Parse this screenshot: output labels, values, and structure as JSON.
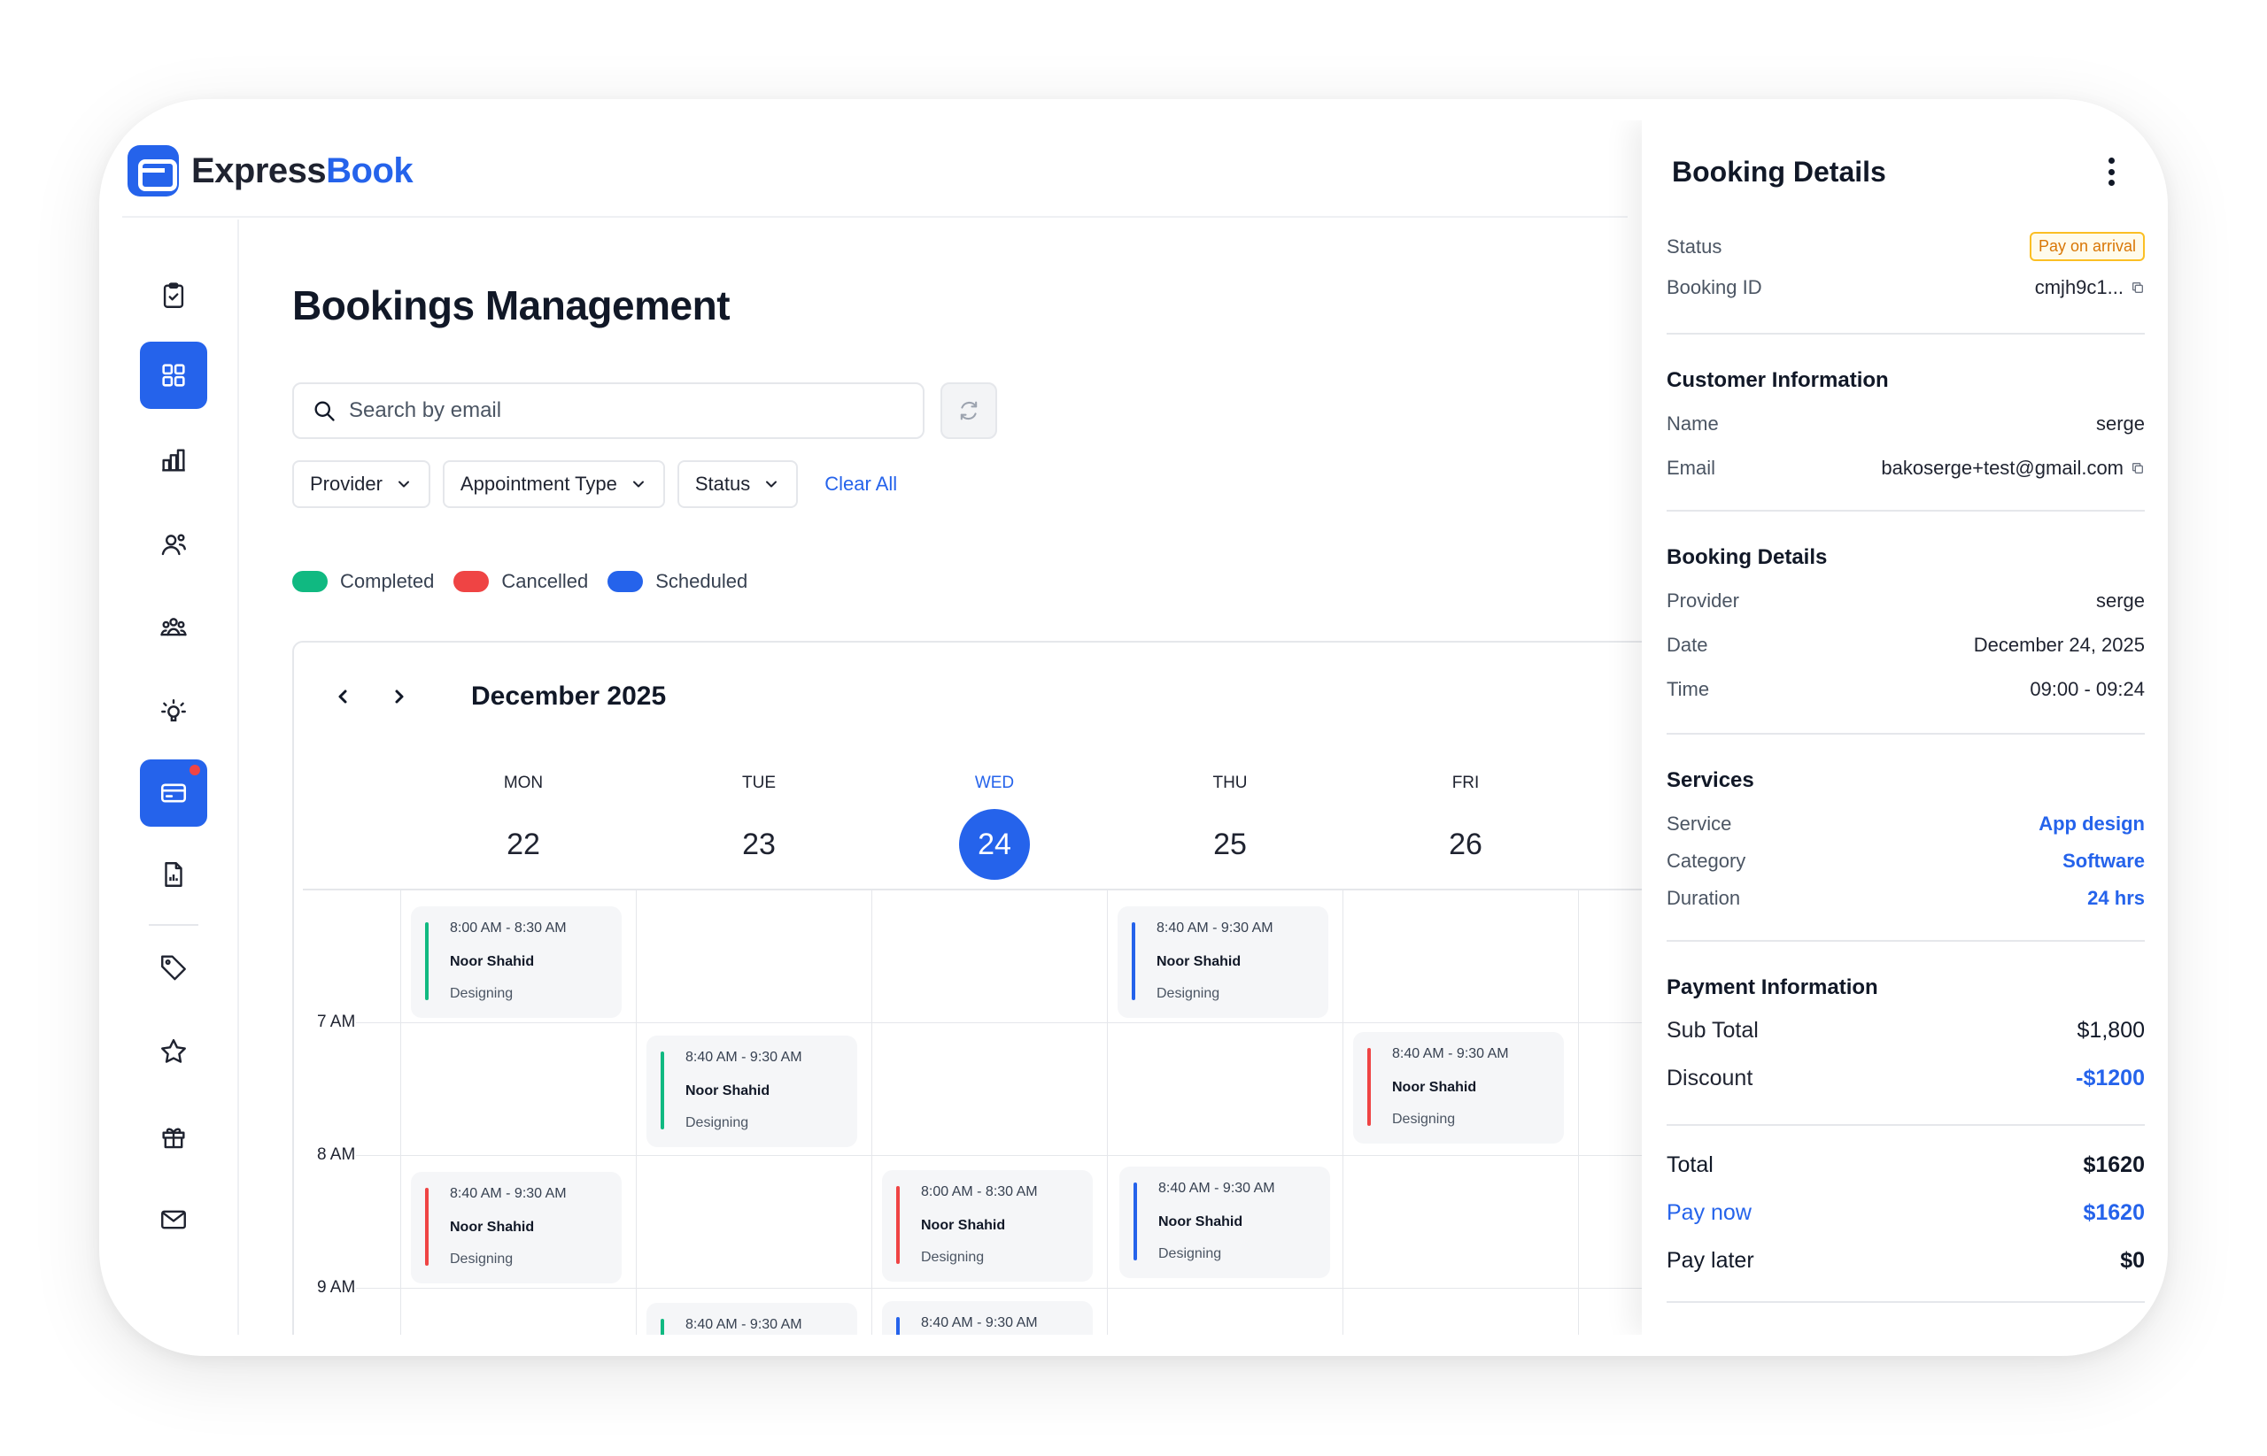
{
  "app": {
    "brand_part1": "Express",
    "brand_part2": "Book"
  },
  "page": {
    "title": "Bookings Management"
  },
  "search": {
    "placeholder": "Search by email",
    "value": ""
  },
  "filters": {
    "provider": "Provider",
    "appointment_type": "Appointment Type",
    "status": "Status",
    "clear_all": "Clear All"
  },
  "legend": [
    {
      "label": "Completed",
      "color": "#10b981"
    },
    {
      "label": "Cancelled",
      "color": "#ef4444"
    },
    {
      "label": "Scheduled",
      "color": "#2563eb"
    }
  ],
  "sidebar": {
    "items": [
      {
        "icon": "clipboard-check-icon",
        "active": false
      },
      {
        "icon": "grid-icon",
        "active": true
      },
      {
        "icon": "bar-chart-icon",
        "active": false
      },
      {
        "icon": "users-icon",
        "active": false
      },
      {
        "icon": "team-icon",
        "active": false
      },
      {
        "icon": "lightbulb-icon",
        "active": false
      },
      {
        "icon": "card-icon",
        "active": true,
        "notification": true
      },
      {
        "icon": "report-icon",
        "active": false
      },
      {
        "icon": "tag-icon",
        "active": false
      },
      {
        "icon": "star-icon",
        "active": false
      },
      {
        "icon": "gift-icon",
        "active": false
      },
      {
        "icon": "mail-icon",
        "active": false
      }
    ]
  },
  "calendar": {
    "month": "December 2025",
    "days": [
      {
        "name": "MON",
        "num": "22"
      },
      {
        "name": "TUE",
        "num": "23"
      },
      {
        "name": "WED",
        "num": "24",
        "today": true
      },
      {
        "name": "THU",
        "num": "25"
      },
      {
        "name": "FRI",
        "num": "26"
      }
    ],
    "times": [
      "7 AM",
      "8 AM",
      "9 AM"
    ],
    "events": [
      {
        "time": "8:00 AM - 8:30 AM",
        "name": "Noor Shahid",
        "category": "Designing",
        "status_color": "#10b981"
      },
      {
        "time": "8:40 AM - 9:30 AM",
        "name": "Noor Shahid",
        "category": "Designing",
        "status_color": "#2563eb"
      },
      {
        "time": "8:40 AM - 9:30 AM",
        "name": "Noor Shahid",
        "category": "Designing",
        "status_color": "#10b981"
      },
      {
        "time": "8:40 AM - 9:30 AM",
        "name": "Noor Shahid",
        "category": "Designing",
        "status_color": "#ef4444"
      },
      {
        "time": "8:40 AM - 9:30 AM",
        "name": "Noor Shahid",
        "category": "Designing",
        "status_color": "#ef4444"
      },
      {
        "time": "8:00 AM - 8:30 AM",
        "name": "Noor Shahid",
        "category": "Designing",
        "status_color": "#ef4444"
      },
      {
        "time": "8:40 AM - 9:30 AM",
        "name": "Noor Shahid",
        "category": "Designing",
        "status_color": "#2563eb"
      },
      {
        "time": "8:40 AM - 9:30 AM",
        "name": "",
        "category": "",
        "status_color": "#10b981"
      },
      {
        "time": "8:40 AM - 9:30 AM",
        "name": "",
        "category": "",
        "status_color": "#2563eb"
      }
    ]
  },
  "panel": {
    "title": "Booking Details",
    "status_label": "Status",
    "status_value": "Pay on arrival",
    "booking_id_label": "Booking ID",
    "booking_id_value": "cmjh9c1...",
    "customer_title": "Customer Information",
    "name_label": "Name",
    "name_value": "serge",
    "email_label": "Email",
    "email_value": "bakoserge+test@gmail.com",
    "booking_title": "Booking Details",
    "provider_label": "Provider",
    "provider_value": "serge",
    "date_label": "Date",
    "date_value": "December 24, 2025",
    "time_label": "Time",
    "time_value": "09:00 - 09:24",
    "services_title": "Services",
    "service_label": "Service",
    "service_value": "App design",
    "category_label": "Category",
    "category_value": "Software",
    "duration_label": "Duration",
    "duration_value": "24 hrs",
    "payment_title": "Payment Information",
    "subtotal_label": "Sub Total",
    "subtotal_value": "$1,800",
    "discount_label": "Discount",
    "discount_value": "-$1200",
    "total_label": "Total",
    "total_value": "$1620",
    "paynow_label": "Pay now",
    "paynow_value": "$1620",
    "paylater_label": "Pay later",
    "paylater_value": "$0"
  }
}
